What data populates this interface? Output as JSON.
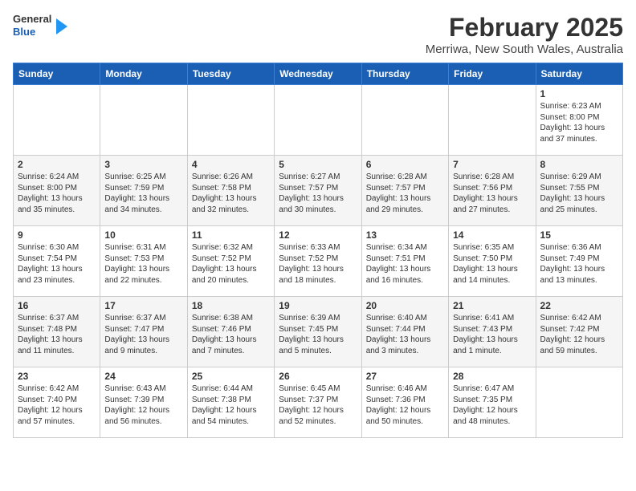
{
  "header": {
    "logo_general": "General",
    "logo_blue": "Blue",
    "month": "February 2025",
    "location": "Merriwa, New South Wales, Australia"
  },
  "weekdays": [
    "Sunday",
    "Monday",
    "Tuesday",
    "Wednesday",
    "Thursday",
    "Friday",
    "Saturday"
  ],
  "weeks": [
    [
      {
        "day": "",
        "info": ""
      },
      {
        "day": "",
        "info": ""
      },
      {
        "day": "",
        "info": ""
      },
      {
        "day": "",
        "info": ""
      },
      {
        "day": "",
        "info": ""
      },
      {
        "day": "",
        "info": ""
      },
      {
        "day": "1",
        "info": "Sunrise: 6:23 AM\nSunset: 8:00 PM\nDaylight: 13 hours\nand 37 minutes."
      }
    ],
    [
      {
        "day": "2",
        "info": "Sunrise: 6:24 AM\nSunset: 8:00 PM\nDaylight: 13 hours\nand 35 minutes."
      },
      {
        "day": "3",
        "info": "Sunrise: 6:25 AM\nSunset: 7:59 PM\nDaylight: 13 hours\nand 34 minutes."
      },
      {
        "day": "4",
        "info": "Sunrise: 6:26 AM\nSunset: 7:58 PM\nDaylight: 13 hours\nand 32 minutes."
      },
      {
        "day": "5",
        "info": "Sunrise: 6:27 AM\nSunset: 7:57 PM\nDaylight: 13 hours\nand 30 minutes."
      },
      {
        "day": "6",
        "info": "Sunrise: 6:28 AM\nSunset: 7:57 PM\nDaylight: 13 hours\nand 29 minutes."
      },
      {
        "day": "7",
        "info": "Sunrise: 6:28 AM\nSunset: 7:56 PM\nDaylight: 13 hours\nand 27 minutes."
      },
      {
        "day": "8",
        "info": "Sunrise: 6:29 AM\nSunset: 7:55 PM\nDaylight: 13 hours\nand 25 minutes."
      }
    ],
    [
      {
        "day": "9",
        "info": "Sunrise: 6:30 AM\nSunset: 7:54 PM\nDaylight: 13 hours\nand 23 minutes."
      },
      {
        "day": "10",
        "info": "Sunrise: 6:31 AM\nSunset: 7:53 PM\nDaylight: 13 hours\nand 22 minutes."
      },
      {
        "day": "11",
        "info": "Sunrise: 6:32 AM\nSunset: 7:52 PM\nDaylight: 13 hours\nand 20 minutes."
      },
      {
        "day": "12",
        "info": "Sunrise: 6:33 AM\nSunset: 7:52 PM\nDaylight: 13 hours\nand 18 minutes."
      },
      {
        "day": "13",
        "info": "Sunrise: 6:34 AM\nSunset: 7:51 PM\nDaylight: 13 hours\nand 16 minutes."
      },
      {
        "day": "14",
        "info": "Sunrise: 6:35 AM\nSunset: 7:50 PM\nDaylight: 13 hours\nand 14 minutes."
      },
      {
        "day": "15",
        "info": "Sunrise: 6:36 AM\nSunset: 7:49 PM\nDaylight: 13 hours\nand 13 minutes."
      }
    ],
    [
      {
        "day": "16",
        "info": "Sunrise: 6:37 AM\nSunset: 7:48 PM\nDaylight: 13 hours\nand 11 minutes."
      },
      {
        "day": "17",
        "info": "Sunrise: 6:37 AM\nSunset: 7:47 PM\nDaylight: 13 hours\nand 9 minutes."
      },
      {
        "day": "18",
        "info": "Sunrise: 6:38 AM\nSunset: 7:46 PM\nDaylight: 13 hours\nand 7 minutes."
      },
      {
        "day": "19",
        "info": "Sunrise: 6:39 AM\nSunset: 7:45 PM\nDaylight: 13 hours\nand 5 minutes."
      },
      {
        "day": "20",
        "info": "Sunrise: 6:40 AM\nSunset: 7:44 PM\nDaylight: 13 hours\nand 3 minutes."
      },
      {
        "day": "21",
        "info": "Sunrise: 6:41 AM\nSunset: 7:43 PM\nDaylight: 13 hours\nand 1 minute."
      },
      {
        "day": "22",
        "info": "Sunrise: 6:42 AM\nSunset: 7:42 PM\nDaylight: 12 hours\nand 59 minutes."
      }
    ],
    [
      {
        "day": "23",
        "info": "Sunrise: 6:42 AM\nSunset: 7:40 PM\nDaylight: 12 hours\nand 57 minutes."
      },
      {
        "day": "24",
        "info": "Sunrise: 6:43 AM\nSunset: 7:39 PM\nDaylight: 12 hours\nand 56 minutes."
      },
      {
        "day": "25",
        "info": "Sunrise: 6:44 AM\nSunset: 7:38 PM\nDaylight: 12 hours\nand 54 minutes."
      },
      {
        "day": "26",
        "info": "Sunrise: 6:45 AM\nSunset: 7:37 PM\nDaylight: 12 hours\nand 52 minutes."
      },
      {
        "day": "27",
        "info": "Sunrise: 6:46 AM\nSunset: 7:36 PM\nDaylight: 12 hours\nand 50 minutes."
      },
      {
        "day": "28",
        "info": "Sunrise: 6:47 AM\nSunset: 7:35 PM\nDaylight: 12 hours\nand 48 minutes."
      },
      {
        "day": "",
        "info": ""
      }
    ]
  ]
}
